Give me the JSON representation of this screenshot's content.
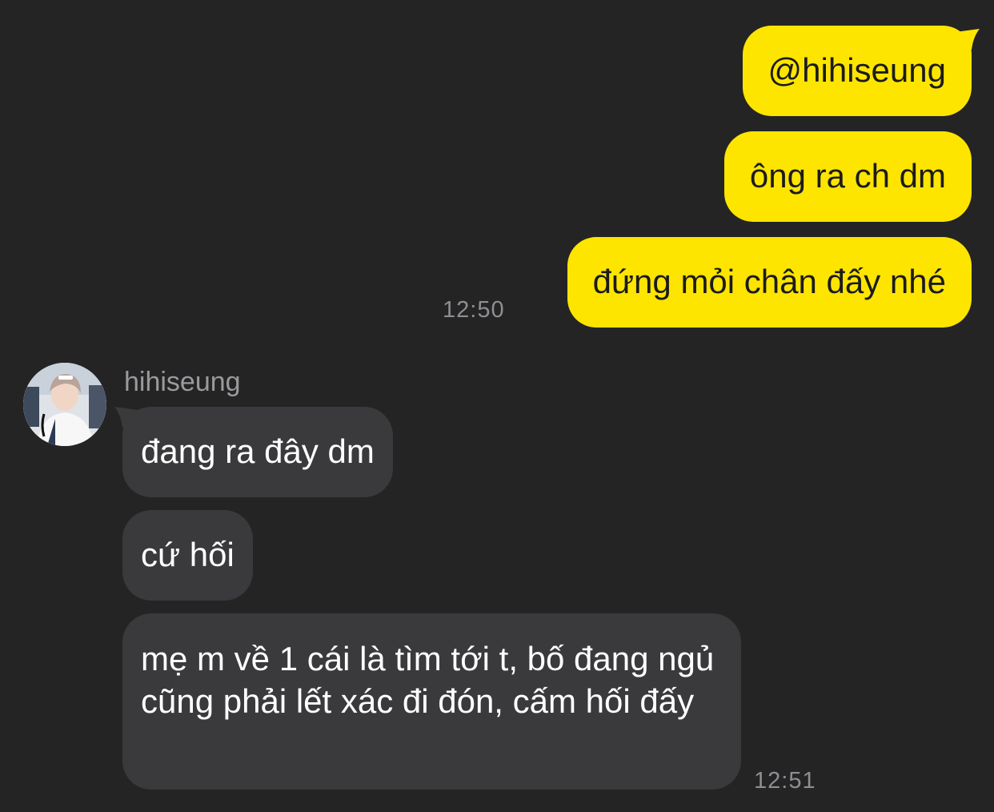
{
  "chat": {
    "outgoing": [
      {
        "text": "@hihiseung"
      },
      {
        "text": "ông ra ch dm"
      },
      {
        "text": "đứng mỏi chân đấy nhé"
      }
    ],
    "outgoing_time": "12:50",
    "incoming_sender": "hihiseung",
    "incoming": [
      {
        "text": "đang ra đây dm"
      },
      {
        "text": "cứ hối"
      },
      {
        "text": "mẹ m về 1 cái là tìm tới t, bố đang ngủ cũng phải lết xác đi đón, cấm hối đấy"
      }
    ],
    "incoming_time": "12:51"
  },
  "colors": {
    "background": "#242425",
    "outgoing_bubble": "#FEE500",
    "incoming_bubble": "#3a3a3c",
    "timestamp": "#8e8e93"
  }
}
